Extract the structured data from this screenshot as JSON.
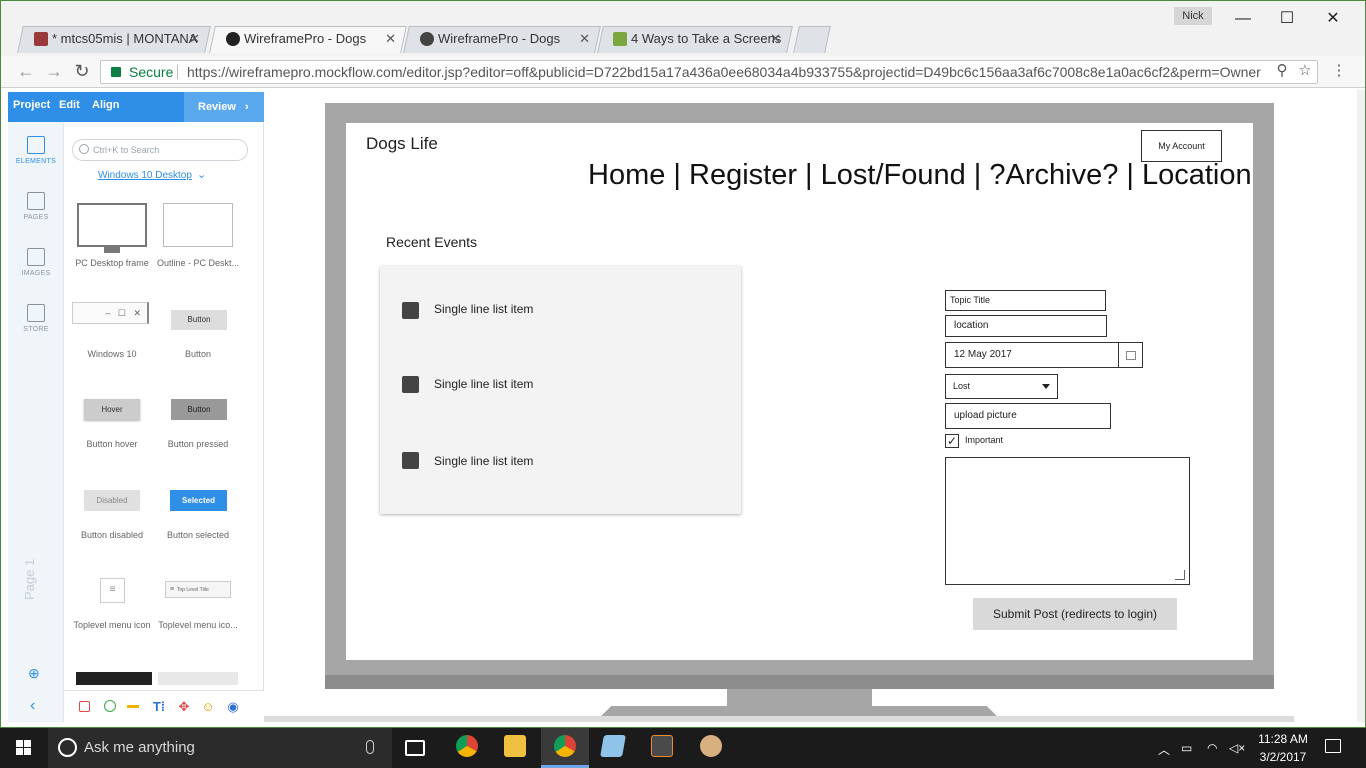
{
  "browser": {
    "tabs": [
      {
        "title": "* mtcs05mis | MONTANA",
        "close": "✕",
        "favicon_color": "#9a3a3a"
      },
      {
        "title": "WireframePro - Dogs",
        "close": "✕",
        "favicon_color": "#222222"
      },
      {
        "title": "WireframePro - Dogs",
        "close": "✕",
        "favicon_color": "#444444"
      },
      {
        "title": "4 Ways to Take a Screens",
        "close": "✕",
        "favicon_color": "#7aa83e"
      }
    ],
    "user": "Nick",
    "window_controls": {
      "minimize": "—",
      "maximize": "☐",
      "close": "✕"
    },
    "secure_label": "Secure",
    "url": "https://wireframepro.mockflow.com/editor.jsp?editor=off&publicid=D722bd15a17a436a0ee68034a4b933755&projectid=D49bc6c156aa3af6c7008c8e1a0ac6cf2&perm=Owner"
  },
  "mockflow": {
    "menu": {
      "project": "Project",
      "edit": "Edit",
      "align": "Align",
      "review": "Review"
    },
    "rail": [
      {
        "label": "ELEMENTS",
        "icon": "cube-icon"
      },
      {
        "label": "PAGES",
        "icon": "pages-icon"
      },
      {
        "label": "IMAGES",
        "icon": "images-icon"
      },
      {
        "label": "STORE",
        "icon": "store-icon"
      }
    ],
    "search_placeholder": "Ctrl+K to Search",
    "library": "Windows 10 Desktop",
    "components": {
      "pc_desktop": "PC Desktop frame",
      "outline_pc": "Outline - PC Deskt...",
      "windows10": "Windows 10",
      "button": "Button",
      "button_thumb": "Button",
      "hover_thumb": "Hover",
      "button_hover": "Button hover",
      "pressed_thumb": "Button",
      "button_pressed": "Button pressed",
      "disabled_thumb": "Disabled",
      "button_disabled": "Button disabled",
      "selected_thumb": "Selected",
      "button_selected": "Button selected",
      "toplevel_icon": "Toplevel menu icon",
      "toplevel_icon2": "Toplevel menu ico...",
      "toplevel_thumb": "Top Level Title"
    },
    "page_label": "Page 1"
  },
  "wireframe": {
    "site_title": "Dogs Life",
    "account_button": "My Account",
    "nav": "Home | Register | Lost/Found | ?Archive? | Location",
    "recent_heading": "Recent Events",
    "list_items": [
      "Single line list item",
      "Single line list item",
      "Single line list item"
    ],
    "form": {
      "topic_title": "Topic Title",
      "location": "location",
      "date": "12 May 2017",
      "status": "Lost",
      "upload": "upload picture",
      "important": "Important",
      "important_checked": "✓",
      "submit": "Submit Post (redirects to login)"
    }
  },
  "taskbar": {
    "search": "Ask me anything",
    "time": "11:28 AM",
    "date": "3/2/2017"
  }
}
